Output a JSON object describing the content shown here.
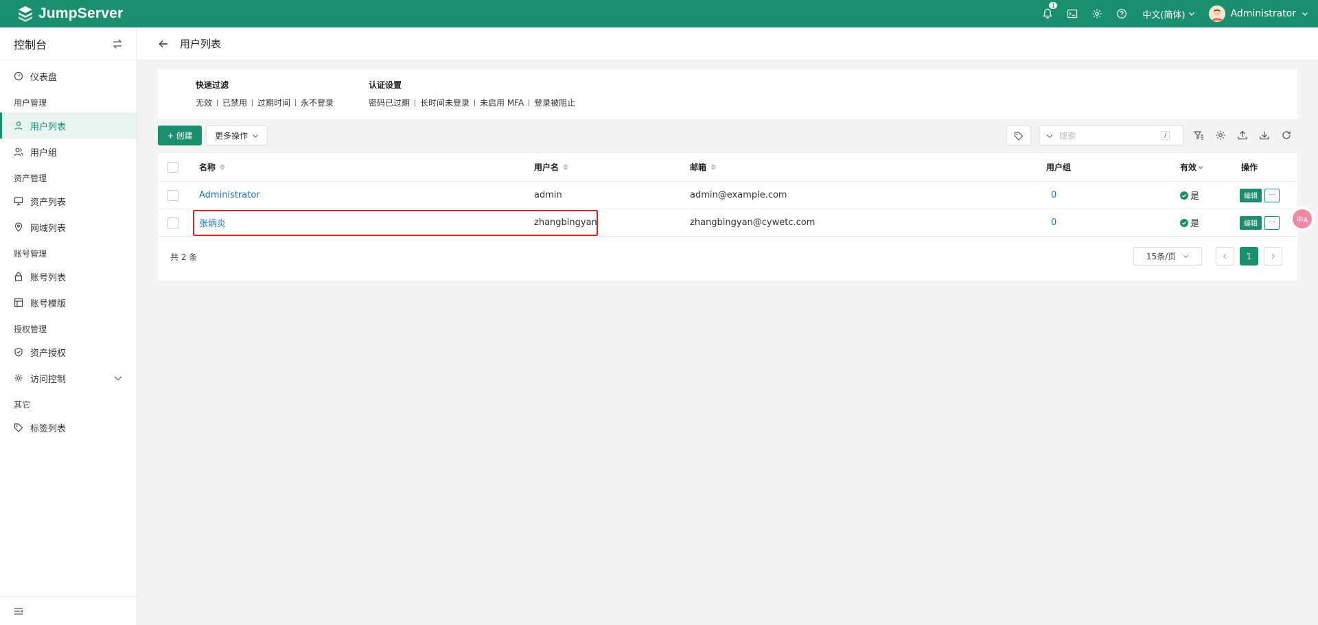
{
  "app": {
    "name": "JumpServer"
  },
  "topbar": {
    "notification_count": "1",
    "language": "中文(简体)",
    "user_name": "Administrator",
    "icons": [
      "bell-icon",
      "terminal-icon",
      "gear-icon",
      "help-icon"
    ]
  },
  "sidebar": {
    "title": "控制台",
    "items": {
      "dashboard": "仪表盘",
      "group_user_mgmt": "用户管理",
      "user_list": "用户列表",
      "user_group": "用户组",
      "group_asset_mgmt": "资产管理",
      "asset_list": "资产列表",
      "zone_list": "网域列表",
      "group_account_mgmt": "账号管理",
      "account_list": "账号列表",
      "account_template": "账号模版",
      "group_perm_mgmt": "授权管理",
      "asset_perm": "资产授权",
      "access_control": "访问控制",
      "group_other": "其它",
      "label_list": "标签列表"
    }
  },
  "page": {
    "title": "用户列表"
  },
  "filters": {
    "quick": {
      "title": "快速过滤",
      "links": [
        "无效",
        "已禁用",
        "过期时间",
        "永不登录"
      ]
    },
    "auth": {
      "title": "认证设置",
      "links": [
        "密码已过期",
        "长时间未登录",
        "未启用 MFA",
        "登录被阻止"
      ]
    }
  },
  "toolbar": {
    "create_label": "创建",
    "more_label": "更多操作",
    "search_placeholder": "搜索",
    "search_shortcut": "/"
  },
  "table": {
    "columns": {
      "name": "名称",
      "username": "用户名",
      "email": "邮箱",
      "groups": "用户组",
      "valid": "有效",
      "actions": "操作"
    },
    "rows": [
      {
        "name": "Administrator",
        "username": "admin",
        "email": "admin@example.com",
        "groups": "0",
        "valid": "是"
      },
      {
        "name": "张炳炎",
        "username": "zhangbingyan",
        "email": "zhangbingyan@cywetc.com",
        "groups": "0",
        "valid": "是"
      }
    ],
    "edit_label": "编辑",
    "more_label": "···"
  },
  "pagination": {
    "total": "共 2 条",
    "page_size": "15条/页",
    "current_page": "1"
  },
  "float_button": {
    "label": "中A"
  },
  "colors": {
    "brand": "#1a8f6e",
    "link": "#1a73c7",
    "highlight": "#e02020"
  }
}
